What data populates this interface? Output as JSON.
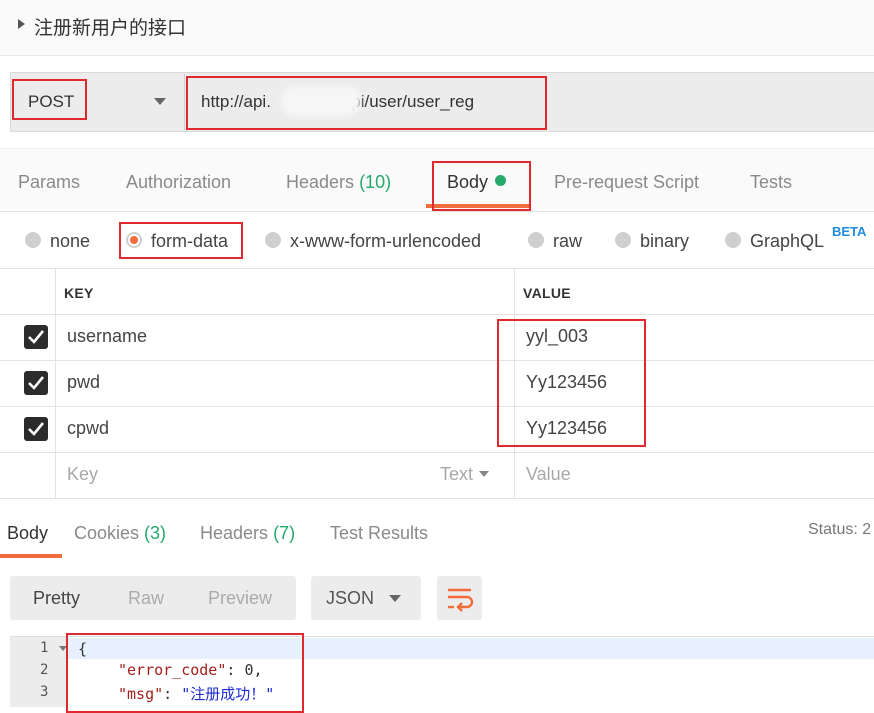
{
  "request": {
    "title": "注册新用户的接口",
    "method": "POST",
    "url": "http://api.            n/api/user/user_reg"
  },
  "request_tabs": [
    {
      "label": "Params",
      "count": ""
    },
    {
      "label": "Authorization",
      "count": ""
    },
    {
      "label": "Headers",
      "count": "(10)"
    },
    {
      "label": "Body",
      "count": ""
    },
    {
      "label": "Pre-request Script",
      "count": ""
    },
    {
      "label": "Tests",
      "count": ""
    }
  ],
  "body_types": [
    "none",
    "form-data",
    "x-www-form-urlencoded",
    "raw",
    "binary",
    "GraphQL"
  ],
  "body_type_selected": "form-data",
  "graphql_badge": "BETA",
  "table": {
    "headers": [
      "KEY",
      "VALUE"
    ],
    "rows": [
      {
        "key": "username",
        "value": "yyl_003",
        "checked": true
      },
      {
        "key": "pwd",
        "value": "Yy123456",
        "checked": true
      },
      {
        "key": "cpwd",
        "value": "Yy123456",
        "checked": true
      }
    ],
    "new_row": {
      "key_placeholder": "Key",
      "type_label": "Text",
      "value_placeholder": "Value"
    }
  },
  "response_tabs": [
    {
      "label": "Body",
      "count": ""
    },
    {
      "label": "Cookies",
      "count": "(3)"
    },
    {
      "label": "Headers",
      "count": "(7)"
    },
    {
      "label": "Test Results",
      "count": ""
    }
  ],
  "status_label": "Status: 2",
  "view_modes": [
    "Pretty",
    "Raw",
    "Preview"
  ],
  "format": "JSON",
  "code": {
    "line_numbers": [
      "1",
      "2",
      "3"
    ],
    "line1": "{",
    "line2_key": "\"error_code\"",
    "line2_sep": ": ",
    "line2_val": "0",
    "line2_end": ",",
    "line3_key": "\"msg\"",
    "line3_sep": ": ",
    "line3_val": "\"注册成功！\""
  },
  "colors": {
    "accent": "#f26b3a",
    "count_green": "#26a96b",
    "highlight_red": "#e0292f"
  }
}
